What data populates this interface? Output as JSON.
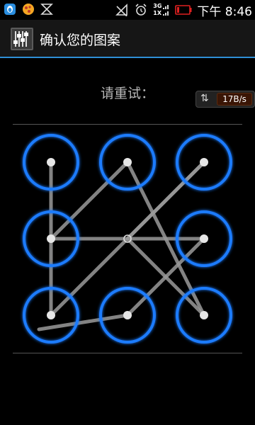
{
  "status_bar": {
    "icons_left": [
      "qq-icon",
      "pizza-app-icon",
      "usb-debug-icon"
    ],
    "icons_right": [
      "no-sim-icon",
      "alarm-clock-icon",
      "network-3g-icon",
      "battery-icon"
    ],
    "net_top": "3G",
    "net_bottom": "1X",
    "time": "下午 8:46"
  },
  "title_bar": {
    "title": "确认您的图案",
    "accent_color": "#2f8fd6"
  },
  "screen": {
    "prompt": "请重试：",
    "speed_indicator": "17B/s"
  },
  "pattern": {
    "grid": "3x3",
    "ring_color": "#1e7bff",
    "path_color": "#9a9a9a",
    "path_dots": [
      1,
      7,
      3,
      5,
      9,
      2,
      4,
      6,
      8
    ]
  }
}
